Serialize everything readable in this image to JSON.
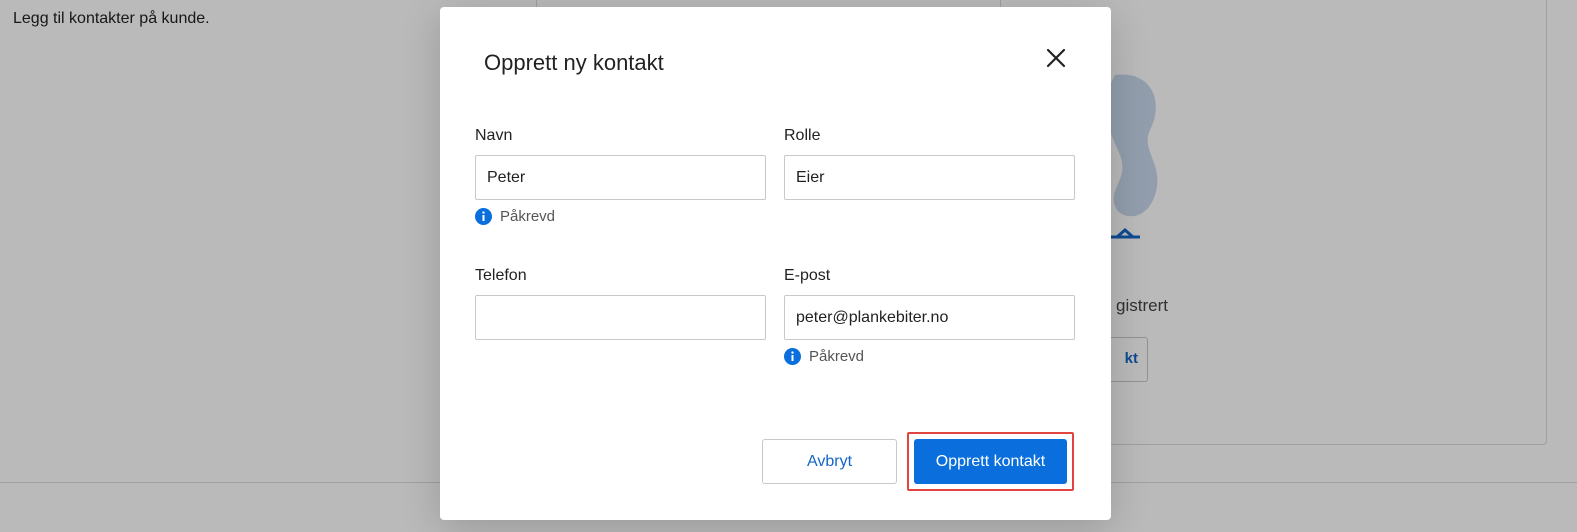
{
  "background": {
    "hint_text": "Legg til kontakter på kunde.",
    "empty_state_text": "gistrert",
    "add_button_label": "kt"
  },
  "modal": {
    "title": "Opprett ny kontakt",
    "fields": {
      "name": {
        "label": "Navn",
        "value": "Peter",
        "helper": "Påkrevd"
      },
      "role": {
        "label": "Rolle",
        "value": "Eier"
      },
      "phone": {
        "label": "Telefon",
        "value": ""
      },
      "email": {
        "label": "E-post",
        "value": "peter@plankebiter.no",
        "helper": "Påkrevd"
      }
    },
    "buttons": {
      "cancel_label": "Avbryt",
      "create_label": "Opprett kontakt"
    }
  },
  "colors": {
    "primary": "#0a6fdc",
    "link": "#1466c8",
    "focus_outline": "#e0463f",
    "info": "#0a6fdc"
  },
  "icons": {
    "close": "close-icon",
    "info": "info-icon"
  }
}
